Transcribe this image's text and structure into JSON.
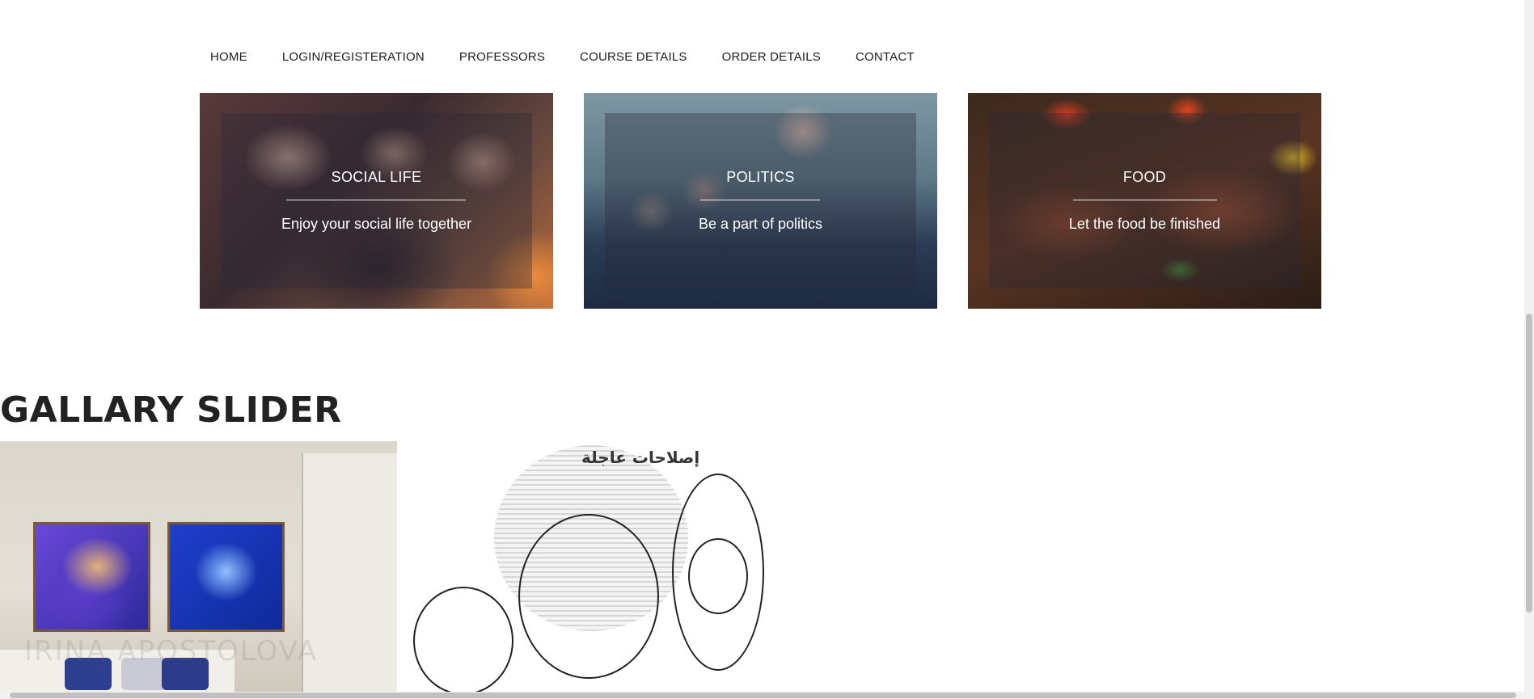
{
  "nav": {
    "items": [
      {
        "label": "HOME"
      },
      {
        "label": "LOGIN/REGISTERATION"
      },
      {
        "label": "PROFESSORS"
      },
      {
        "label": "COURSE DETAILS"
      },
      {
        "label": "ORDER DETAILS"
      },
      {
        "label": "CONTACT"
      }
    ]
  },
  "cards": [
    {
      "title": "SOCIAL LIFE",
      "subtitle": "Enjoy your social life together"
    },
    {
      "title": "POLITICS",
      "subtitle": "Be a part of politics"
    },
    {
      "title": "FOOD",
      "subtitle": "Let the food be finished"
    }
  ],
  "gallery": {
    "title": "GALLARY SLIDER",
    "slides": [
      {
        "watermark": "IRINA APOSTOLOVA"
      },
      {
        "headline": "إصلاحات عاجلة"
      }
    ]
  },
  "colors": {
    "text": "#222222",
    "card_overlay": "rgba(40,40,55,0.35)",
    "scrollbar_thumb": "#c1c1c1"
  }
}
